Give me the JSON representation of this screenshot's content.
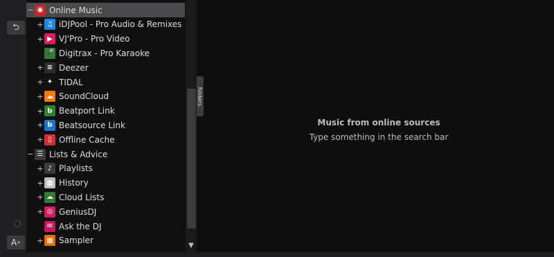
{
  "tree": {
    "items": [
      {
        "label": "Online Music",
        "expander": "−",
        "icon": "online-music-icon",
        "color": "#c62828",
        "level": 0,
        "selected": true,
        "glyph": "◉"
      },
      {
        "label": "iDJPool - Pro Audio & Remixes",
        "expander": "+",
        "icon": "idjpool-icon",
        "color": "#1e88e5",
        "level": 1,
        "glyph": "♫"
      },
      {
        "label": "VJ'Pro - Pro Video",
        "expander": "+",
        "icon": "vjpro-icon",
        "color": "#d81b60",
        "level": 1,
        "glyph": "▶"
      },
      {
        "label": "Digitrax - Pro Karaoke",
        "expander": "",
        "icon": "digitrax-icon",
        "color": "#2e7d32",
        "level": 1,
        "glyph": "🎤"
      },
      {
        "label": "Deezer",
        "expander": "+",
        "icon": "deezer-icon",
        "color": "#2b2b2b",
        "level": 1,
        "glyph": "≡"
      },
      {
        "label": "TIDAL",
        "expander": "+",
        "icon": "tidal-icon",
        "color": "#111111",
        "level": 1,
        "glyph": "✦"
      },
      {
        "label": "SoundCloud",
        "expander": "+",
        "icon": "soundcloud-icon",
        "color": "#f57c00",
        "level": 1,
        "glyph": "☁"
      },
      {
        "label": "Beatport Link",
        "expander": "+",
        "icon": "beatport-icon",
        "color": "#2e7d32",
        "level": 1,
        "glyph": "b"
      },
      {
        "label": "Beatsource Link",
        "expander": "+",
        "icon": "beatsource-icon",
        "color": "#1976d2",
        "level": 1,
        "glyph": "b"
      },
      {
        "label": "Offline Cache",
        "expander": "+",
        "icon": "offline-cache-icon",
        "color": "#d32f2f",
        "level": 1,
        "glyph": "▯"
      },
      {
        "label": "Lists & Advice",
        "expander": "−",
        "icon": "lists-advice-icon",
        "color": "#3a3a3c",
        "level": 0,
        "glyph": "☰"
      },
      {
        "label": "Playlists",
        "expander": "+",
        "icon": "playlists-icon",
        "color": "#3a3a3c",
        "level": 1,
        "glyph": "♪"
      },
      {
        "label": "History",
        "expander": "+",
        "icon": "history-icon",
        "color": "#bdbdbd",
        "level": 1,
        "glyph": "▦"
      },
      {
        "label": "Cloud Lists",
        "expander": "+",
        "icon": "cloud-lists-icon",
        "color": "#2e7d32",
        "level": 1,
        "glyph": "☁"
      },
      {
        "label": "GeniusDJ",
        "expander": "+",
        "icon": "geniusdj-icon",
        "color": "#d81b60",
        "level": 1,
        "glyph": "◎"
      },
      {
        "label": "Ask the DJ",
        "expander": "",
        "icon": "ask-the-dj-icon",
        "color": "#c2185b",
        "level": 1,
        "glyph": "✉"
      },
      {
        "label": "Sampler",
        "expander": "+",
        "icon": "sampler-icon",
        "color": "#ef6c00",
        "level": 1,
        "glyph": "▦"
      }
    ]
  },
  "folders_tab": {
    "label": "folders"
  },
  "main": {
    "title": "Music from online sources",
    "subtitle": "Type something in the search bar"
  },
  "rail": {
    "back_icon": "back-icon",
    "font_button_label": "A",
    "font_button_icon": "font-size-icon"
  }
}
